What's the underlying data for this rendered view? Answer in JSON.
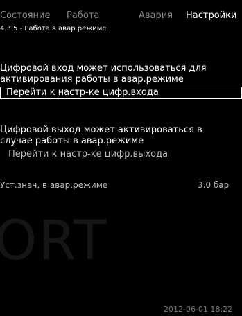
{
  "tabs": [
    {
      "label": "Состояние",
      "active": false
    },
    {
      "label": "Работа",
      "active": false
    },
    {
      "label": "Авария",
      "active": false
    },
    {
      "label": "Настройки",
      "active": true
    }
  ],
  "breadcrumb": "4.3.5 - Работа в авар.режиме",
  "section1": {
    "line1": "Цифровой вход может использоваться для",
    "line2": "активирования работы в авар.режиме",
    "link": "Перейти к настр-ке цифр.входа"
  },
  "section2": {
    "line1": "Цифровой выход может активироваться в",
    "line2": "случае работы в авар.режиме",
    "link": "Перейти к настр-ке цифр.выхода"
  },
  "setpoint": {
    "label": "Уст.знач, в авар.режиме",
    "value": "3.0 бар"
  },
  "watermark": "ORT",
  "clock": "2012-06-01 18:22"
}
